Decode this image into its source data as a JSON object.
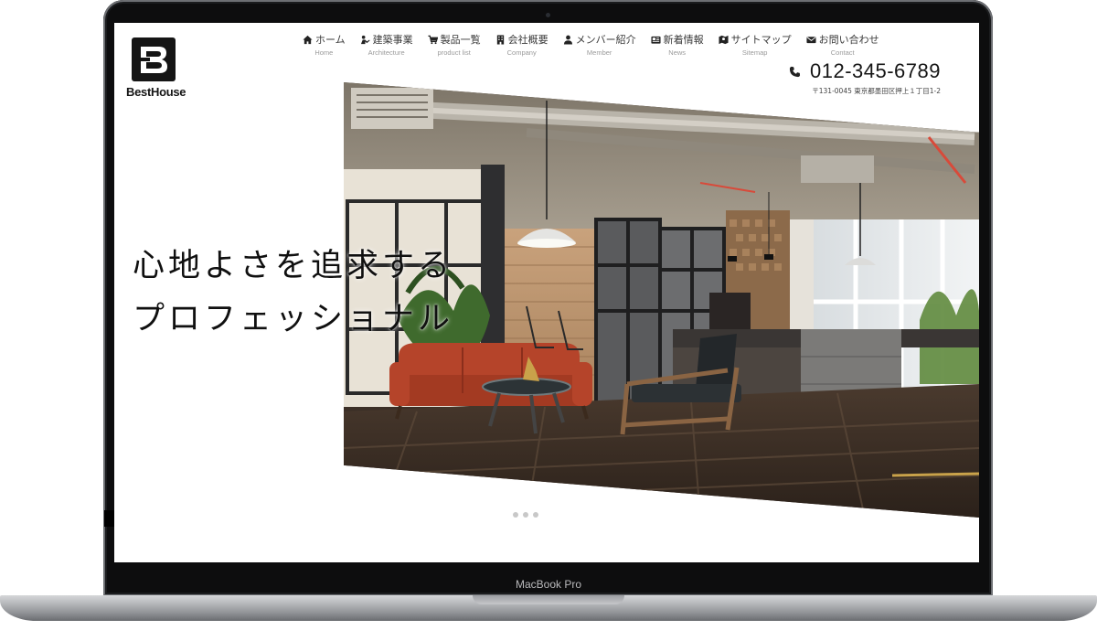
{
  "site": {
    "logo_text": "BestHouse",
    "logo_glyph": "B"
  },
  "nav": {
    "items": [
      {
        "ja": "ホーム",
        "en": "Home",
        "icon": "home-icon"
      },
      {
        "ja": "建築事業",
        "en": "Architecture",
        "icon": "worker-icon"
      },
      {
        "ja": "製品一覧",
        "en": "product list",
        "icon": "cart-icon"
      },
      {
        "ja": "会社概要",
        "en": "Company",
        "icon": "building-icon"
      },
      {
        "ja": "メンバー紹介",
        "en": "Member",
        "icon": "person-icon"
      },
      {
        "ja": "新着情報",
        "en": "News",
        "icon": "newspaper-icon"
      },
      {
        "ja": "サイトマップ",
        "en": "Sitemap",
        "icon": "map-icon"
      },
      {
        "ja": "お問い合わせ",
        "en": "Contact",
        "icon": "envelope-icon"
      }
    ]
  },
  "contact": {
    "phone": "012-345-6789",
    "address": "〒131-0045 東京都墨田区押上１丁目1-2"
  },
  "hero": {
    "line1": "心地よさを追求する",
    "line2": "プロフェッショナル",
    "slide_count": 3
  },
  "device": {
    "label": "MacBook Pro"
  },
  "colors": {
    "text_dark": "#151515",
    "nav_sub": "#9a9a9a",
    "sofa": "#b5442a",
    "floor": "#3b2f27"
  }
}
